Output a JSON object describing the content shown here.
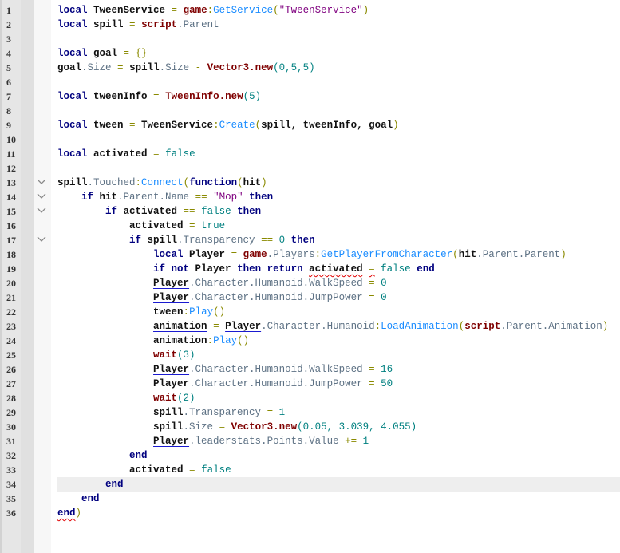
{
  "editor": {
    "current_line": 34,
    "folded_lines": [
      13,
      14,
      15,
      17
    ],
    "colors": {
      "keyword": "#00007f",
      "builtin": "#7f0000",
      "property": "#5d7184",
      "method": "#1a8cff",
      "number": "#008080",
      "string": "#7f007f",
      "operator": "#8a8a00",
      "current_line_bg": "#eeeeee"
    },
    "lines": [
      {
        "n": "1",
        "indent": 0,
        "tokens": [
          [
            "local",
            "kw"
          ],
          [
            " TweenService ",
            "id"
          ],
          [
            "=",
            "op"
          ],
          [
            " "
          ],
          [
            "game",
            "bi"
          ],
          [
            ":",
            "op"
          ],
          [
            "GetService",
            "fn"
          ],
          [
            "(",
            "op"
          ],
          [
            "\"TweenService\"",
            "str"
          ],
          [
            ")",
            "op"
          ]
        ]
      },
      {
        "n": "2",
        "indent": 0,
        "tokens": [
          [
            "local",
            "kw"
          ],
          [
            " spill ",
            "id"
          ],
          [
            "=",
            "op"
          ],
          [
            " "
          ],
          [
            "script",
            "bi"
          ],
          [
            ".Parent",
            "prop"
          ]
        ]
      },
      {
        "n": "3",
        "indent": 0,
        "tokens": []
      },
      {
        "n": "4",
        "indent": 0,
        "tokens": [
          [
            "local",
            "kw"
          ],
          [
            " goal ",
            "id"
          ],
          [
            "=",
            "op"
          ],
          [
            " "
          ],
          [
            "{}",
            "op"
          ]
        ]
      },
      {
        "n": "5",
        "indent": 0,
        "tokens": [
          [
            "goal",
            "id"
          ],
          [
            ".Size ",
            "prop"
          ],
          [
            "=",
            "op"
          ],
          [
            " "
          ],
          [
            "spill",
            "id"
          ],
          [
            ".Size ",
            "prop"
          ],
          [
            "-",
            "op"
          ],
          [
            " "
          ],
          [
            "Vector3.new",
            "bi"
          ],
          [
            "(0,5,5)",
            "num2"
          ]
        ]
      },
      {
        "n": "6",
        "indent": 0,
        "tokens": []
      },
      {
        "n": "7",
        "indent": 0,
        "tokens": [
          [
            "local",
            "kw"
          ],
          [
            " tweenInfo ",
            "id"
          ],
          [
            "=",
            "op"
          ],
          [
            " "
          ],
          [
            "TweenInfo.new",
            "bi"
          ],
          [
            "(5)",
            "num2"
          ]
        ]
      },
      {
        "n": "8",
        "indent": 0,
        "tokens": []
      },
      {
        "n": "9",
        "indent": 0,
        "tokens": [
          [
            "local",
            "kw"
          ],
          [
            " tween ",
            "id"
          ],
          [
            "=",
            "op"
          ],
          [
            " TweenService",
            "id"
          ],
          [
            ":",
            "op"
          ],
          [
            "Create",
            "fn"
          ],
          [
            "(",
            "op"
          ],
          [
            "spill, tweenInfo, goal",
            "id"
          ],
          [
            ")",
            "op"
          ]
        ]
      },
      {
        "n": "10",
        "indent": 0,
        "tokens": []
      },
      {
        "n": "11",
        "indent": 0,
        "tokens": [
          [
            "local",
            "kw"
          ],
          [
            " activated ",
            "id"
          ],
          [
            "=",
            "op"
          ],
          [
            " "
          ],
          [
            "false",
            "num2"
          ]
        ]
      },
      {
        "n": "12",
        "indent": 0,
        "tokens": []
      },
      {
        "n": "13",
        "indent": 0,
        "tokens": [
          [
            "spill",
            "id"
          ],
          [
            ".Touched",
            "prop"
          ],
          [
            ":",
            "op"
          ],
          [
            "Connect",
            "fn"
          ],
          [
            "(",
            "op"
          ],
          [
            "function",
            "kw"
          ],
          [
            "(",
            "op"
          ],
          [
            "hit",
            "id"
          ],
          [
            ")",
            "op"
          ]
        ]
      },
      {
        "n": "14",
        "indent": 1,
        "tokens": [
          [
            "if",
            "kw"
          ],
          [
            " hit",
            "id"
          ],
          [
            ".Parent.Name ",
            "prop"
          ],
          [
            "==",
            "op"
          ],
          [
            " "
          ],
          [
            "\"Mop\"",
            "str"
          ],
          [
            " "
          ],
          [
            "then",
            "kw"
          ]
        ]
      },
      {
        "n": "15",
        "indent": 2,
        "tokens": [
          [
            "if",
            "kw"
          ],
          [
            " activated ",
            "id"
          ],
          [
            "==",
            "op"
          ],
          [
            " "
          ],
          [
            "false",
            "num2"
          ],
          [
            " "
          ],
          [
            "then",
            "kw"
          ]
        ]
      },
      {
        "n": "16",
        "indent": 3,
        "tokens": [
          [
            "activated ",
            "id"
          ],
          [
            "=",
            "op"
          ],
          [
            " "
          ],
          [
            "true",
            "num2"
          ]
        ]
      },
      {
        "n": "17",
        "indent": 3,
        "tokens": [
          [
            "if",
            "kw"
          ],
          [
            " spill",
            "id"
          ],
          [
            ".Transparency ",
            "prop"
          ],
          [
            "==",
            "op"
          ],
          [
            " "
          ],
          [
            "0",
            "num2"
          ],
          [
            " "
          ],
          [
            "then",
            "kw"
          ]
        ]
      },
      {
        "n": "18",
        "indent": 4,
        "tokens": [
          [
            "local",
            "kw"
          ],
          [
            " Player ",
            "id"
          ],
          [
            "=",
            "op"
          ],
          [
            " "
          ],
          [
            "game",
            "bi"
          ],
          [
            ".Players",
            "prop"
          ],
          [
            ":",
            "op"
          ],
          [
            "GetPlayerFromCharacter",
            "fn"
          ],
          [
            "(",
            "op"
          ],
          [
            "hit",
            "id"
          ],
          [
            ".Parent.Parent",
            "prop"
          ],
          [
            ")",
            "op"
          ]
        ]
      },
      {
        "n": "19",
        "indent": 4,
        "tokens": [
          [
            "if not",
            "kw"
          ],
          [
            " Player ",
            "id"
          ],
          [
            "then return",
            "kw"
          ],
          [
            " "
          ],
          [
            "activated",
            "id",
            "ur"
          ],
          [
            " "
          ],
          [
            "=",
            "op",
            "ur"
          ],
          [
            " "
          ],
          [
            "false",
            "num2"
          ],
          [
            " "
          ],
          [
            "end",
            "kw"
          ]
        ]
      },
      {
        "n": "20",
        "indent": 4,
        "tokens": [
          [
            "Player",
            "id",
            "ub"
          ],
          [
            ".Character.Humanoid.WalkSpeed ",
            "prop"
          ],
          [
            "=",
            "op"
          ],
          [
            " "
          ],
          [
            "0",
            "num2"
          ]
        ]
      },
      {
        "n": "21",
        "indent": 4,
        "tokens": [
          [
            "Player",
            "id",
            "ub"
          ],
          [
            ".Character.Humanoid.JumpPower ",
            "prop"
          ],
          [
            "=",
            "op"
          ],
          [
            " "
          ],
          [
            "0",
            "num2"
          ]
        ]
      },
      {
        "n": "22",
        "indent": 4,
        "tokens": [
          [
            "tween",
            "id"
          ],
          [
            ":",
            "op"
          ],
          [
            "Play",
            "fn"
          ],
          [
            "()",
            "op"
          ]
        ]
      },
      {
        "n": "23",
        "indent": 4,
        "tokens": [
          [
            "animation",
            "id",
            "ub"
          ],
          [
            " "
          ],
          [
            "=",
            "op"
          ],
          [
            " "
          ],
          [
            "Player",
            "id",
            "ub"
          ],
          [
            ".Character.Humanoid",
            "prop"
          ],
          [
            ":",
            "op"
          ],
          [
            "LoadAnimation",
            "fn"
          ],
          [
            "(",
            "op"
          ],
          [
            "script",
            "bi"
          ],
          [
            ".Parent.Animation",
            "prop"
          ],
          [
            ")",
            "op"
          ]
        ]
      },
      {
        "n": "24",
        "indent": 4,
        "tokens": [
          [
            "animation",
            "id"
          ],
          [
            ":",
            "op"
          ],
          [
            "Play",
            "fn"
          ],
          [
            "()",
            "op"
          ]
        ]
      },
      {
        "n": "25",
        "indent": 4,
        "tokens": [
          [
            "wait",
            "bi"
          ],
          [
            "(3)",
            "num2"
          ]
        ]
      },
      {
        "n": "26",
        "indent": 4,
        "tokens": [
          [
            "Player",
            "id",
            "ub"
          ],
          [
            ".Character.Humanoid.WalkSpeed ",
            "prop"
          ],
          [
            "=",
            "op"
          ],
          [
            " "
          ],
          [
            "16",
            "num2"
          ]
        ]
      },
      {
        "n": "27",
        "indent": 4,
        "tokens": [
          [
            "Player",
            "id",
            "ub"
          ],
          [
            ".Character.Humanoid.JumpPower ",
            "prop"
          ],
          [
            "=",
            "op"
          ],
          [
            " "
          ],
          [
            "50",
            "num2"
          ]
        ]
      },
      {
        "n": "28",
        "indent": 4,
        "tokens": [
          [
            "wait",
            "bi"
          ],
          [
            "(2)",
            "num2"
          ]
        ]
      },
      {
        "n": "29",
        "indent": 4,
        "tokens": [
          [
            "spill",
            "id"
          ],
          [
            ".Transparency ",
            "prop"
          ],
          [
            "=",
            "op"
          ],
          [
            " "
          ],
          [
            "1",
            "num2"
          ]
        ]
      },
      {
        "n": "30",
        "indent": 4,
        "tokens": [
          [
            "spill",
            "id"
          ],
          [
            ".Size ",
            "prop"
          ],
          [
            "=",
            "op"
          ],
          [
            " "
          ],
          [
            "Vector3.new",
            "bi"
          ],
          [
            "(0.05, 3.039, 4.055)",
            "num2"
          ]
        ]
      },
      {
        "n": "31",
        "indent": 4,
        "tokens": [
          [
            "Player",
            "id",
            "ub"
          ],
          [
            ".leaderstats.Points.Value ",
            "prop"
          ],
          [
            "+=",
            "op"
          ],
          [
            " "
          ],
          [
            "1",
            "num2"
          ]
        ]
      },
      {
        "n": "32",
        "indent": 3,
        "tokens": [
          [
            "end",
            "kw"
          ]
        ]
      },
      {
        "n": "33",
        "indent": 3,
        "tokens": [
          [
            "activated ",
            "id"
          ],
          [
            "=",
            "op"
          ],
          [
            " "
          ],
          [
            "false",
            "num2"
          ]
        ]
      },
      {
        "n": "34",
        "indent": 2,
        "tokens": [
          [
            "end",
            "kw"
          ]
        ]
      },
      {
        "n": "35",
        "indent": 1,
        "tokens": [
          [
            "end",
            "kw"
          ]
        ]
      },
      {
        "n": "36",
        "indent": 0,
        "tokens": [
          [
            "end",
            "kw",
            "ur"
          ],
          [
            ")",
            "op"
          ]
        ]
      }
    ]
  }
}
